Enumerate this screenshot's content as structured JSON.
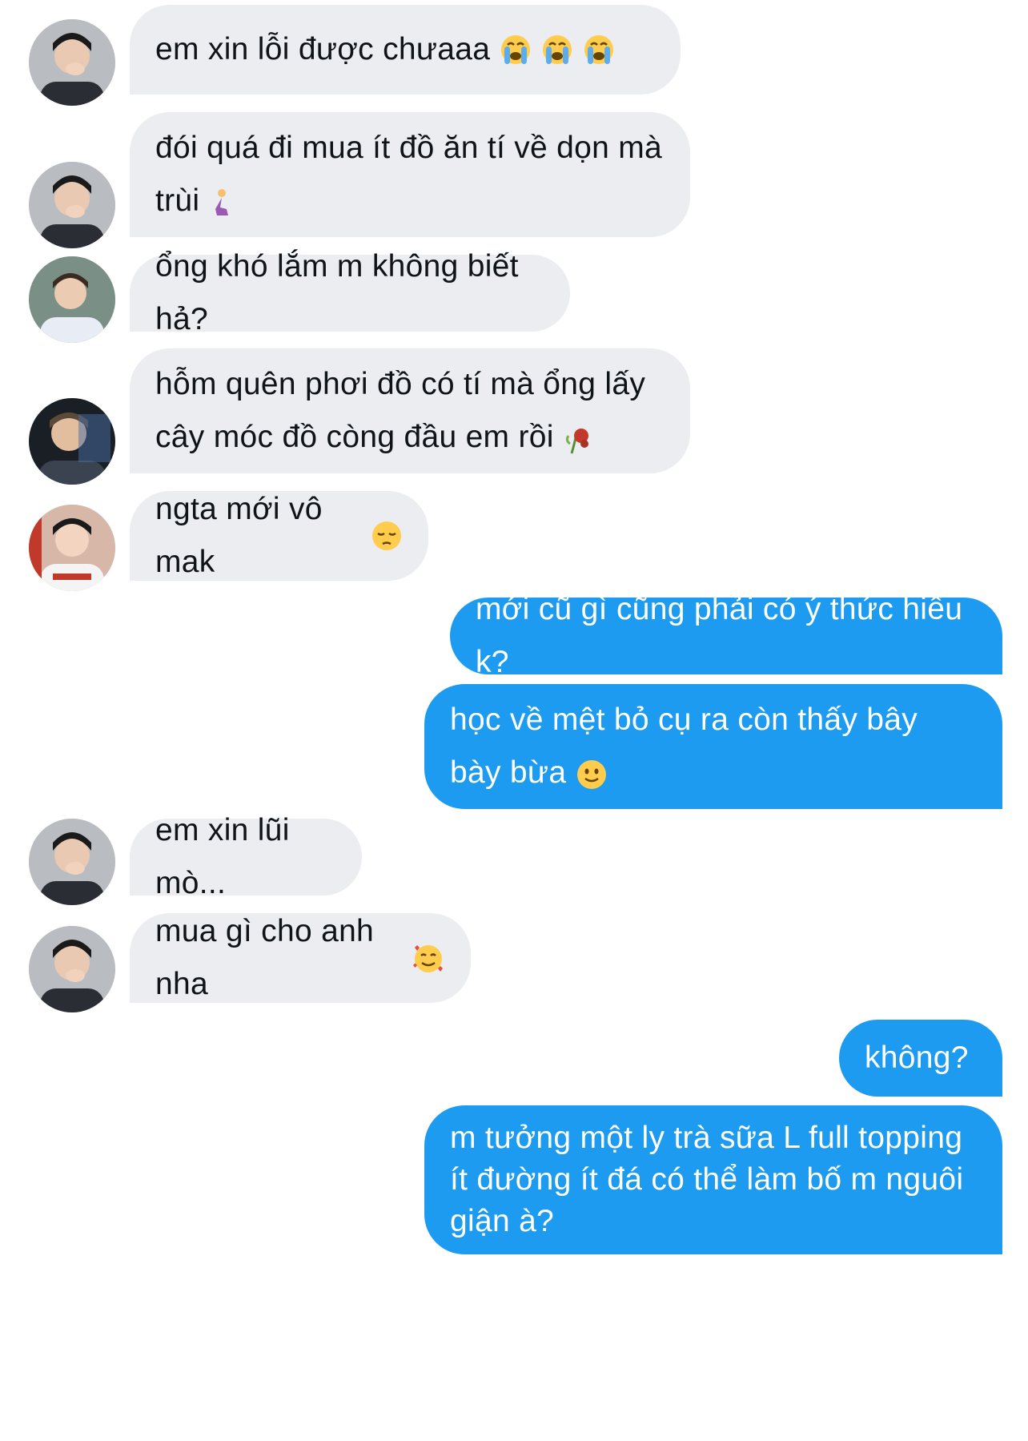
{
  "messages": [
    {
      "side": "in",
      "text": "em xin lỗi được chưaaa",
      "emoji": [
        "loudly-crying-face",
        "loudly-crying-face",
        "loudly-crying-face"
      ]
    },
    {
      "side": "in",
      "text": "đói quá đi mua ít đồ ăn tí về dọn mà trùi",
      "emoji": [
        "person-kneeling"
      ]
    },
    {
      "side": "in",
      "text": "ổng khó lắm m không biết hả?",
      "emoji": []
    },
    {
      "side": "in",
      "text": "hỗm quên phơi đồ có tí mà ổng lấy cây móc đồ còng đầu em rồi",
      "emoji": [
        "wilted-flower"
      ]
    },
    {
      "side": "in",
      "text": "ngta mới vô mak",
      "emoji": [
        "pensive-face"
      ]
    },
    {
      "side": "out",
      "text": "mới cũ gì cũng phải có ý thức hiểu k?",
      "emoji": []
    },
    {
      "side": "out",
      "text": "học về mệt bỏ cụ ra còn thấy bây bày bừa",
      "emoji": [
        "slightly-smiling-face"
      ]
    },
    {
      "side": "in",
      "text": "em xin lũi mò...",
      "emoji": []
    },
    {
      "side": "in",
      "text": "mua gì cho anh nha",
      "emoji": [
        "smiling-face-with-hearts"
      ]
    },
    {
      "side": "out",
      "text": "không?",
      "emoji": []
    },
    {
      "side": "out",
      "text": "m tưởng một ly trà sữa L full topping ít đường ít đá có thể làm bố m nguôi giận à?",
      "emoji": []
    }
  ],
  "colors": {
    "incoming_bubble": "#ebedf0",
    "outgoing_bubble": "#1d9bf0",
    "incoming_text": "#0f1419",
    "outgoing_text": "#ffffff"
  }
}
